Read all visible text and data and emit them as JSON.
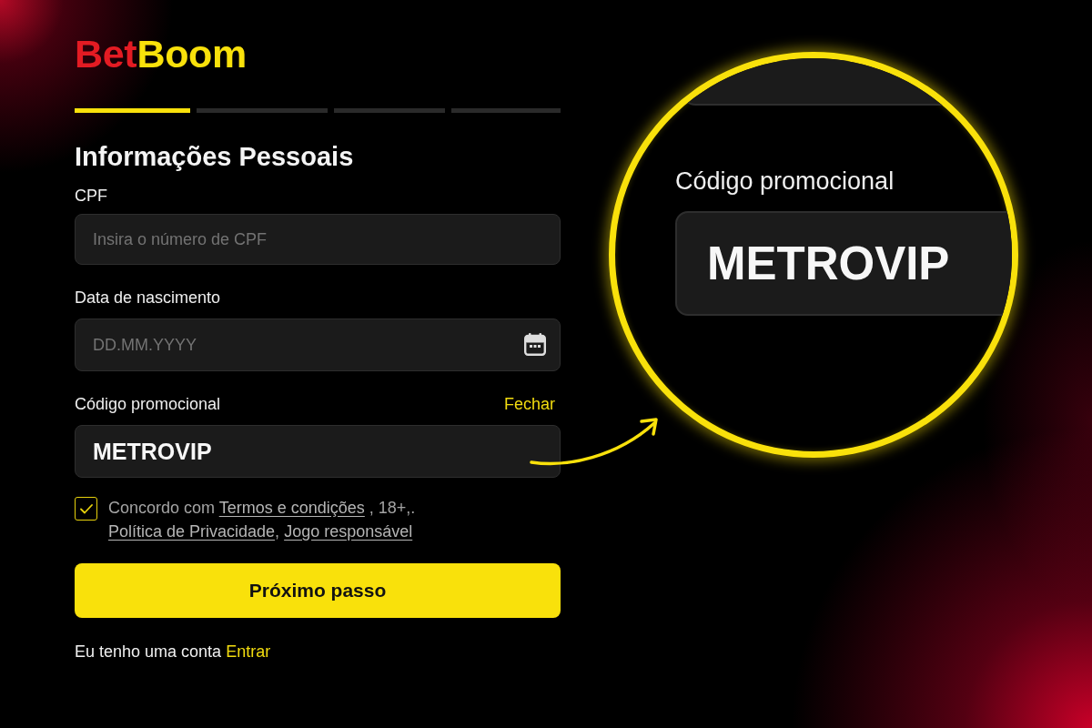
{
  "logo": [
    {
      "text": "Bet",
      "color": "#e31b23"
    },
    {
      "text": "Boom",
      "color": "#f9e10b"
    }
  ],
  "steps": [
    {
      "active": true
    },
    {
      "active": false
    },
    {
      "active": false
    },
    {
      "active": false
    }
  ],
  "title": "Informações Pessoais",
  "fields": [
    {
      "kind": "text",
      "label": "CPF",
      "placeholder": "Insira o número de CPF"
    },
    {
      "kind": "date",
      "label": "Data de nascimento",
      "placeholder": "DD.MM.YYYY"
    },
    {
      "kind": "text",
      "label": "Código promocional",
      "action": "Fechar",
      "value": "METROVIP"
    }
  ],
  "consent": {
    "checked": true,
    "lines": [
      [
        {
          "kind": "text",
          "text": "Concordo com "
        },
        {
          "kind": "link",
          "text": "Termos e condições"
        },
        {
          "kind": "text",
          "text": " , 18+,."
        }
      ],
      [
        {
          "kind": "link",
          "text": "Política de Privacidade"
        },
        {
          "kind": "text",
          "text": ", "
        },
        {
          "kind": "link",
          "text": "Jogo responsável"
        }
      ]
    ]
  },
  "next_button": "Próximo passo",
  "login_prompt": {
    "text": "Eu tenho uma conta",
    "link": "Entrar"
  },
  "magnifier": {
    "label": "Código promocional",
    "value": "METROVIP"
  }
}
